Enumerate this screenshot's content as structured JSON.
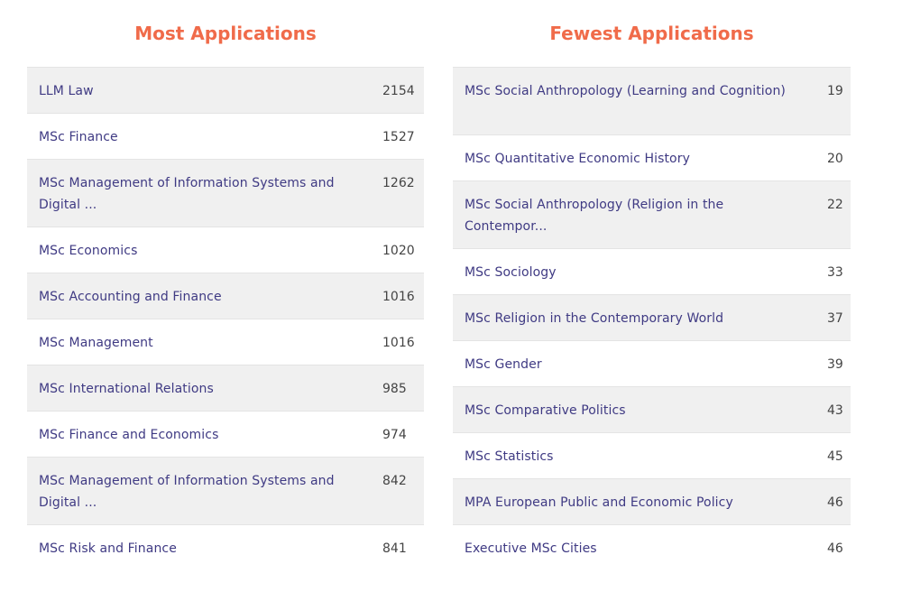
{
  "most": {
    "title": "Most Applications",
    "rows": [
      {
        "name": "LLM Law",
        "count": "2154"
      },
      {
        "name": "MSc Finance",
        "count": "1527"
      },
      {
        "name": "MSc Management of Information Systems and Digital ...",
        "count": "1262"
      },
      {
        "name": "MSc Economics",
        "count": "1020"
      },
      {
        "name": "MSc Accounting and Finance",
        "count": "1016"
      },
      {
        "name": "MSc Management",
        "count": "1016"
      },
      {
        "name": "MSc International Relations",
        "count": "985"
      },
      {
        "name": "MSc Finance and Economics",
        "count": "974"
      },
      {
        "name": "MSc Management of Information Systems and Digital ...",
        "count": "842"
      },
      {
        "name": "MSc Risk and Finance",
        "count": "841"
      }
    ]
  },
  "fewest": {
    "title": "Fewest Applications",
    "rows": [
      {
        "name": "MSc Social Anthropology (Learning and Cognition)",
        "count": "19"
      },
      {
        "name": "MSc Quantitative Economic History",
        "count": "20"
      },
      {
        "name": "MSc Social Anthropology (Religion in the Contempor...",
        "count": "22"
      },
      {
        "name": "MSc Sociology",
        "count": "33"
      },
      {
        "name": "MSc Religion in the Contemporary World",
        "count": "37"
      },
      {
        "name": "MSc Gender",
        "count": "39"
      },
      {
        "name": "MSc Comparative Politics",
        "count": "43"
      },
      {
        "name": "MSc Statistics",
        "count": "45"
      },
      {
        "name": "MPA European Public and Economic Policy",
        "count": "46"
      },
      {
        "name": "Executive MSc Cities",
        "count": "46"
      }
    ]
  }
}
